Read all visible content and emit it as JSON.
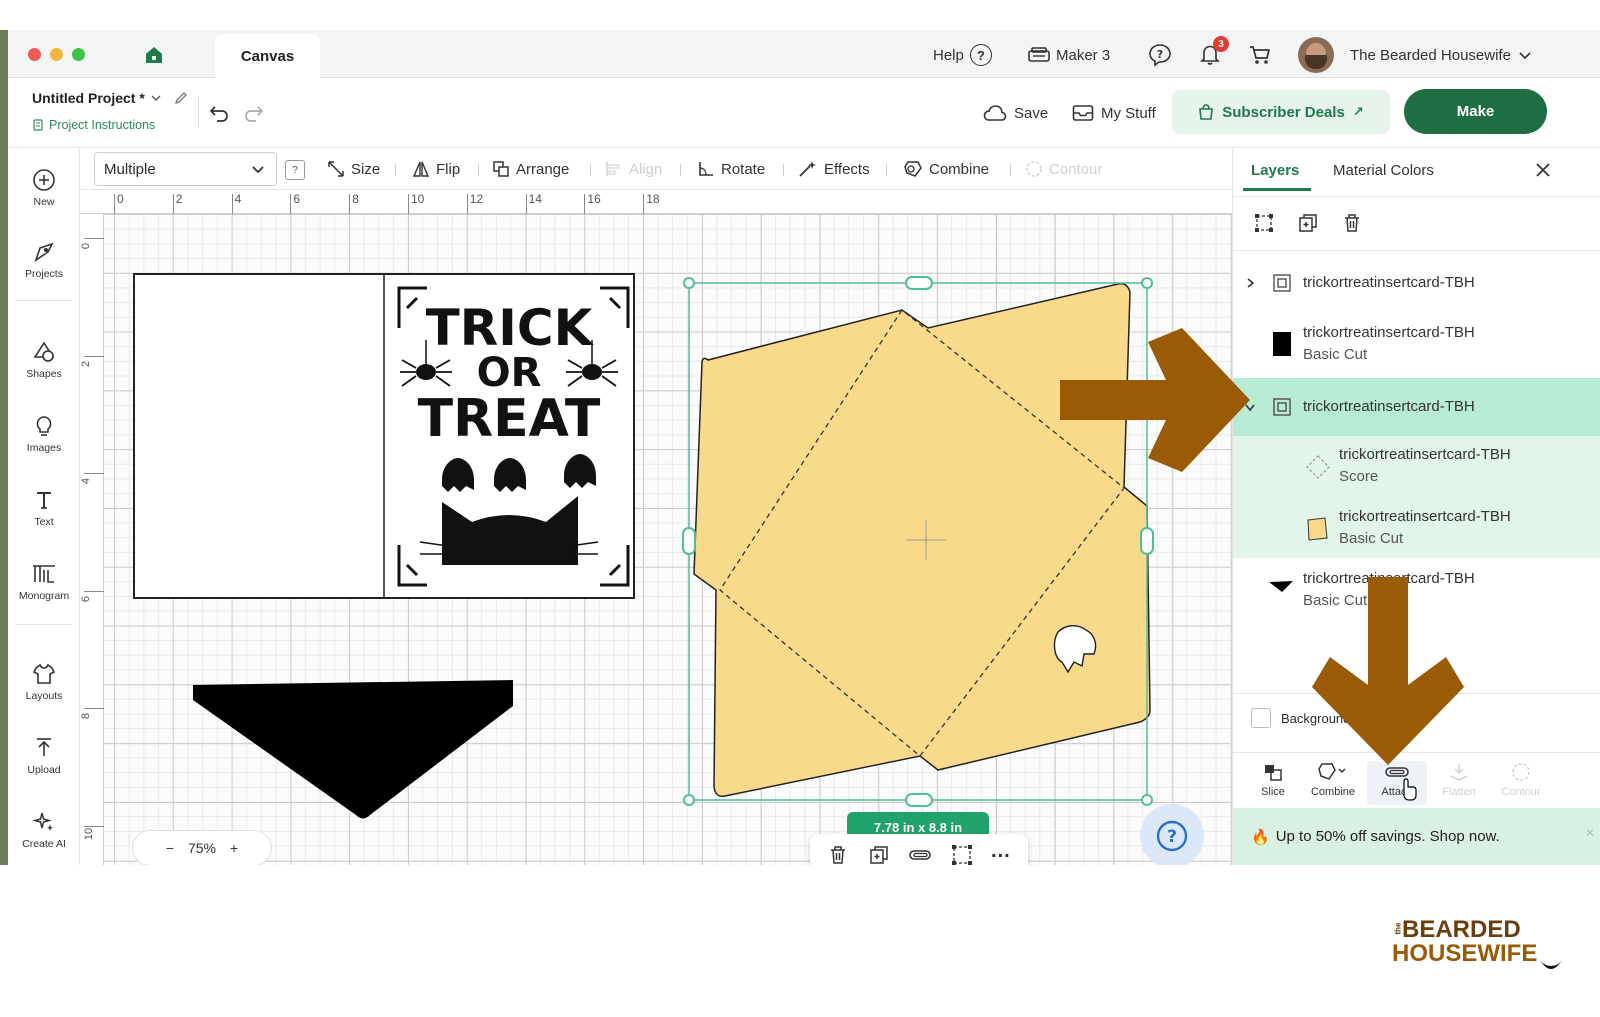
{
  "window": {
    "tab_title": "Canvas",
    "help_label": "Help",
    "machine_label": "Maker 3",
    "notification_count": "3",
    "user_name": "The Bearded Housewife"
  },
  "project": {
    "title": "Untitled Project *",
    "instructions_label": "Project Instructions",
    "save_label": "Save",
    "mystuff_label": "My Stuff",
    "subscriber_label": "Subscriber Deals",
    "make_label": "Make"
  },
  "rail": {
    "items": [
      {
        "label": "New",
        "icon": "plus-circle-icon"
      },
      {
        "label": "Projects",
        "icon": "projects-icon"
      },
      {
        "label": "Shapes",
        "icon": "shapes-icon"
      },
      {
        "label": "Images",
        "icon": "lightbulb-icon"
      },
      {
        "label": "Text",
        "icon": "text-icon"
      },
      {
        "label": "Monogram",
        "icon": "monogram-icon"
      },
      {
        "label": "Layouts",
        "icon": "shirt-icon"
      },
      {
        "label": "Upload",
        "icon": "upload-icon"
      },
      {
        "label": "Create AI",
        "icon": "sparkle-icon"
      }
    ]
  },
  "toolbar": {
    "selection_value": "Multiple",
    "help_hint": "?",
    "size_label": "Size",
    "flip_label": "Flip",
    "arrange_label": "Arrange",
    "align_label": "Align",
    "rotate_label": "Rotate",
    "effects_label": "Effects",
    "combine_label": "Combine",
    "contour_label": "Contour"
  },
  "ruler": {
    "top_labels": [
      "0",
      "2",
      "4",
      "6",
      "8",
      "10",
      "12",
      "14",
      "16",
      "18"
    ],
    "left_labels": [
      "0",
      "2",
      "4",
      "6",
      "8",
      "10"
    ]
  },
  "canvas": {
    "card_text_line1": "TRICK",
    "card_text_line2": "OR",
    "card_text_line3": "TREAT",
    "zoom_value": "75%",
    "zoom_minus": "−",
    "zoom_plus": "+",
    "size_readout": "7.78 in x 8.8 in",
    "envelope_color": "#f9da8b",
    "selection_color": "#4fbf94"
  },
  "panel": {
    "tab_layers": "Layers",
    "tab_colors": "Material Colors",
    "layers": [
      {
        "name": "trickortreatinsertcard-TBH",
        "type": "",
        "kind": "group",
        "expanded": false
      },
      {
        "name": "trickortreatinsertcard-TBH",
        "type": "Basic Cut",
        "kind": "layer",
        "swatch": "#000000"
      },
      {
        "name": "trickortreatinsertcard-TBH",
        "type": "",
        "kind": "group",
        "expanded": true,
        "selected": true
      },
      {
        "name": "trickortreatinsertcard-TBH",
        "type": "Score",
        "kind": "child",
        "swatch": "score"
      },
      {
        "name": "trickortreatinsertcard-TBH",
        "type": "Basic Cut",
        "kind": "child",
        "swatch": "#f9da8b"
      },
      {
        "name": "trickortreatinsertcard-TBH",
        "type": "Basic Cut",
        "kind": "layer",
        "swatch": "#000000"
      }
    ],
    "background_label": "Background",
    "bottom_tools": [
      "Slice",
      "Combine",
      "Attach",
      "Flatten",
      "Contour"
    ],
    "promo_text": "Up to 50% off savings. Shop now."
  },
  "watermark": {
    "small": "the",
    "line1": "BEARDED",
    "line2": "HOUSEWIFE"
  },
  "colors": {
    "brand_green": "#1f6e43",
    "accent_green": "#1f7a4d",
    "selected_row": "#b8ebd3",
    "arrow_brown": "#9a5a06"
  }
}
